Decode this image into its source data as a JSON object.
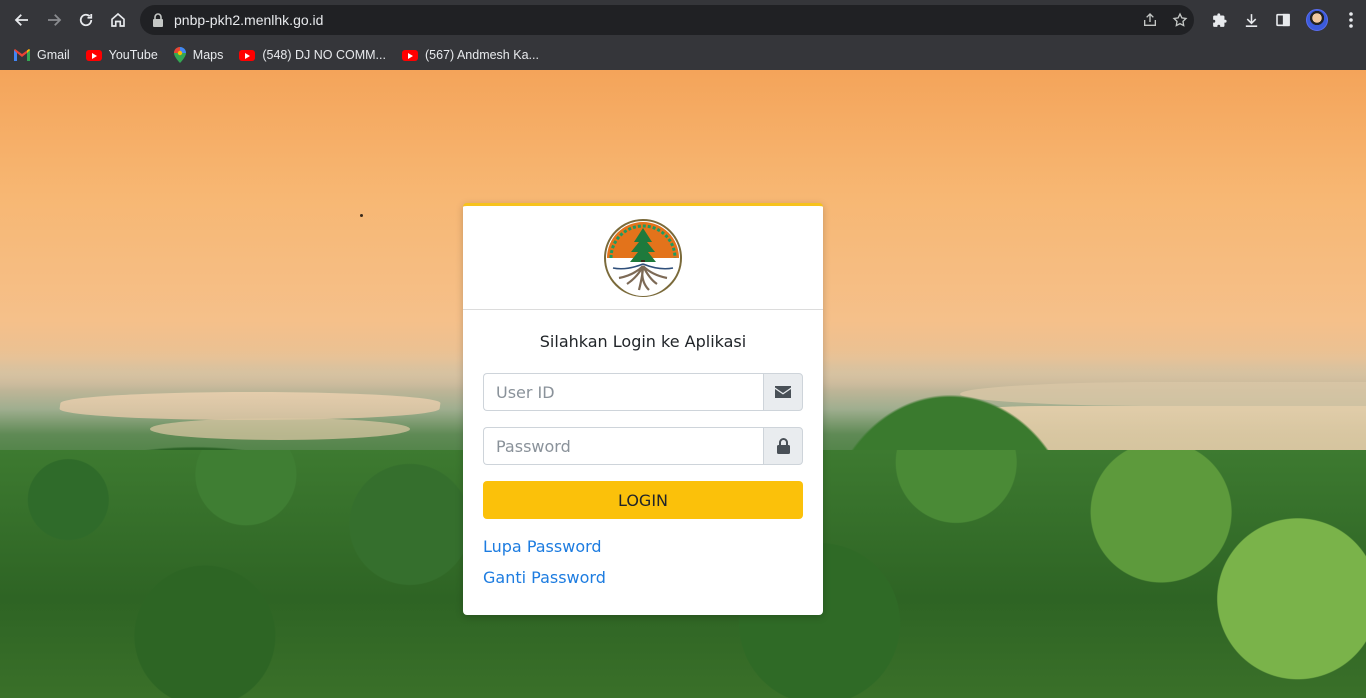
{
  "browser": {
    "url": "pnbp-pkh2.menlhk.go.id",
    "bookmarks": [
      {
        "label": "Gmail",
        "icon": "gmail-icon"
      },
      {
        "label": "YouTube",
        "icon": "youtube-icon"
      },
      {
        "label": "Maps",
        "icon": "maps-icon"
      },
      {
        "label": "(548) DJ NO COMM...",
        "icon": "youtube-icon"
      },
      {
        "label": "(567) Andmesh Ka...",
        "icon": "youtube-icon"
      }
    ]
  },
  "login": {
    "title": "Silahkan Login ke Aplikasi",
    "userid_placeholder": "User ID",
    "password_placeholder": "Password",
    "login_label": "LOGIN",
    "forgot_label": "Lupa Password",
    "change_label": "Ganti Password"
  },
  "colors": {
    "accent": "#fbc10a",
    "link": "#1d7ce0"
  }
}
